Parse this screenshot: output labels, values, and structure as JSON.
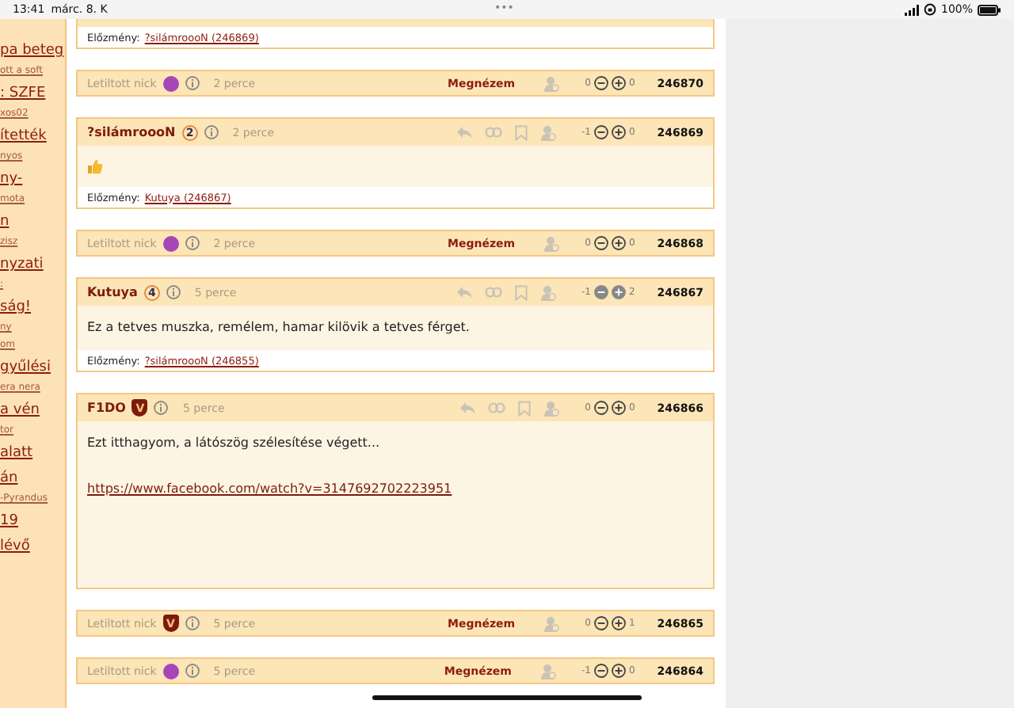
{
  "status_bar": {
    "time": "13:41",
    "date": "márc. 8. K",
    "dots": "•••",
    "battery": "100%"
  },
  "sidebar": {
    "items": [
      {
        "kind": "title",
        "text": "pa beteg"
      },
      {
        "kind": "meta",
        "text": "ott a soft"
      },
      {
        "kind": "title",
        "text": ": SZFE"
      },
      {
        "kind": "meta",
        "text": "xos02"
      },
      {
        "kind": "title",
        "text": "ítették"
      },
      {
        "kind": "meta",
        "text": "nyos"
      },
      {
        "kind": "title",
        "text": "ny-"
      },
      {
        "kind": "meta",
        "text": "mota"
      },
      {
        "kind": "title",
        "text": "n"
      },
      {
        "kind": "meta",
        "text": "zisz"
      },
      {
        "kind": "title",
        "text": "nyzati"
      },
      {
        "kind": "meta",
        "text": ":"
      },
      {
        "kind": "title",
        "text": "ság!"
      },
      {
        "kind": "meta",
        "text": "ny"
      },
      {
        "kind": "meta",
        "text": "om"
      },
      {
        "kind": "title",
        "text": "gyűlési"
      },
      {
        "kind": "meta",
        "text": "era nera"
      },
      {
        "kind": "title",
        "text": "a vén"
      },
      {
        "kind": "meta",
        "text": "tor"
      },
      {
        "kind": "title",
        "text": "alatt"
      },
      {
        "kind": "title",
        "text": "án"
      },
      {
        "kind": "meta",
        "text": "-Pyrandus"
      },
      {
        "kind": "title",
        "text": "19"
      },
      {
        "kind": "title",
        "text": "lévő"
      }
    ]
  },
  "posts": [
    {
      "kind": "partial",
      "previous_label": "Előzmény:",
      "previous_link": "?silámroooN (246869)"
    },
    {
      "kind": "blocked",
      "nick": "Letiltott nick",
      "badge": {
        "kind": "avatar"
      },
      "time": "2 perce",
      "view": "Megnézem",
      "minus": "0",
      "plus": "0",
      "voted": false,
      "number": "246870"
    },
    {
      "kind": "post",
      "nick": "?silámroooN",
      "badge": {
        "kind": "rank",
        "text": "2"
      },
      "time": "2 perce",
      "minus": "-1",
      "plus": "0",
      "voted": false,
      "number": "246869",
      "body": [
        {
          "kind": "thumbs-up"
        }
      ],
      "previous_label": "Előzmény:",
      "previous_link": "Kutuya (246867)"
    },
    {
      "kind": "blocked",
      "nick": "Letiltott nick",
      "badge": {
        "kind": "avatar"
      },
      "time": "2 perce",
      "view": "Megnézem",
      "minus": "0",
      "plus": "0",
      "voted": false,
      "number": "246868"
    },
    {
      "kind": "post",
      "nick": "Kutuya",
      "badge": {
        "kind": "rank",
        "text": "4"
      },
      "time": "5 perce",
      "minus": "-1",
      "plus": "2",
      "voted": true,
      "number": "246867",
      "body": [
        {
          "kind": "text",
          "text": "Ez a tetves muszka, remélem, hamar kilövik a tetves férget."
        }
      ],
      "previous_label": "Előzmény:",
      "previous_link": "?silámroooN (246855)"
    },
    {
      "kind": "post",
      "nick": "F1DO",
      "badge": {
        "kind": "shield",
        "text": "V"
      },
      "time": "5 perce",
      "minus": "0",
      "plus": "0",
      "voted": false,
      "number": "246866",
      "body": [
        {
          "kind": "text",
          "text": "Ezt itthagyom, a látószög szélesítése végett..."
        },
        {
          "kind": "link",
          "text": "https://www.facebook.com/watch?v=3147692702223951"
        }
      ]
    },
    {
      "kind": "blocked",
      "nick": "Letiltott nick",
      "badge": {
        "kind": "shield",
        "text": "V"
      },
      "time": "5 perce",
      "view": "Megnézem",
      "minus": "0",
      "plus": "1",
      "voted": false,
      "number": "246865"
    },
    {
      "kind": "blocked",
      "nick": "Letiltott nick",
      "badge": {
        "kind": "avatar"
      },
      "time": "5 perce",
      "view": "Megnézem",
      "minus": "-1",
      "plus": "0",
      "voted": false,
      "number": "246864"
    }
  ]
}
